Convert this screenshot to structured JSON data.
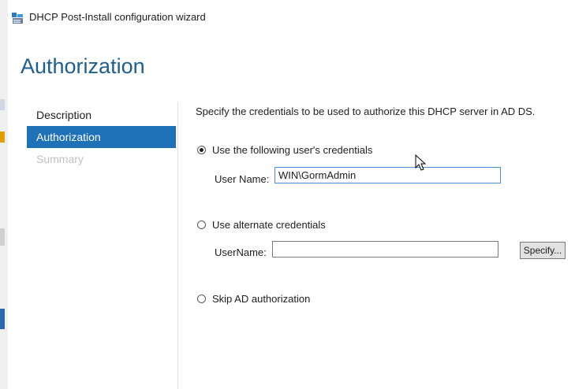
{
  "window": {
    "title": "DHCP Post-Install configuration wizard",
    "icon": "dhcp-server-icon"
  },
  "page": {
    "title": "Authorization"
  },
  "nav": {
    "items": [
      {
        "label": "Description",
        "state": "normal"
      },
      {
        "label": "Authorization",
        "state": "active"
      },
      {
        "label": "Summary",
        "state": "disabled"
      }
    ]
  },
  "content": {
    "intro": "Specify the credentials to be used to authorize this DHCP server in AD DS.",
    "option_user": {
      "label": "Use the following user's credentials",
      "checked": true,
      "username_label": "User Name:",
      "username_value": "WIN\\GormAdmin"
    },
    "option_alternate": {
      "label": "Use alternate credentials",
      "checked": false,
      "username_label": "UserName:",
      "username_value": "",
      "specify_button": "Specify..."
    },
    "option_skip": {
      "label": "Skip AD authorization",
      "checked": false
    }
  },
  "colors": {
    "title": "#1f5f8f",
    "nav_active_bg": "#1f72b8",
    "nav_disabled_text": "#c2c2c2"
  }
}
